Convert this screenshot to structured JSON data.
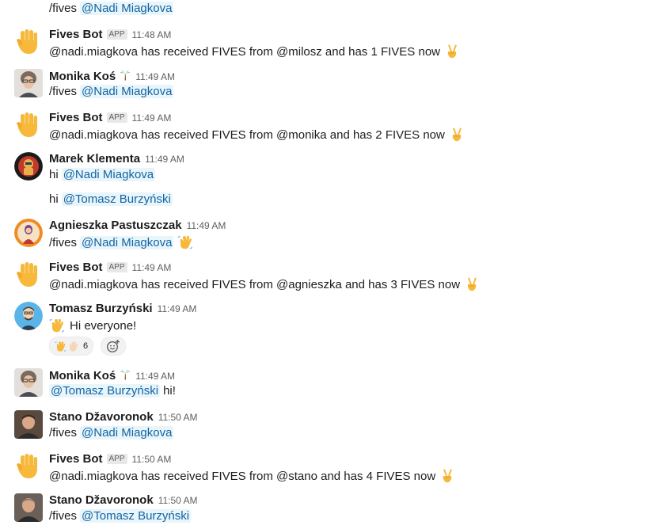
{
  "messages": [
    {
      "name": "",
      "badge": "",
      "time": "",
      "parts": [
        "/fives",
        "@Nadi Miagkova"
      ]
    },
    {
      "name": "Fives Bot",
      "badge": "APP",
      "time": "11:48 AM",
      "text": "@nadi.miagkova has received FIVES from @milosz and has 1 FIVES now"
    },
    {
      "name": "Monika Koś",
      "time": "11:49 AM",
      "parts": [
        "/fives",
        "@Nadi Miagkova"
      ]
    },
    {
      "name": "Fives Bot",
      "badge": "APP",
      "time": "11:49 AM",
      "text": "@nadi.miagkova has received FIVES from @monika and has 2 FIVES now"
    },
    {
      "name": "Marek Klementa",
      "time": "11:49 AM",
      "parts": [
        "hi",
        "@Nadi Miagkova"
      ],
      "parts2": [
        "hi",
        "@Tomasz Burzyński"
      ]
    },
    {
      "name": "Agnieszka Pastuszczak",
      "time": "11:49 AM",
      "parts": [
        "/fives",
        "@Nadi Miagkova"
      ]
    },
    {
      "name": "Fives Bot",
      "badge": "APP",
      "time": "11:49 AM",
      "text": "@nadi.miagkova has received FIVES from @agnieszka and has 3 FIVES now"
    },
    {
      "name": "Tomasz Burzyński",
      "time": "11:49 AM",
      "text": "Hi everyone!",
      "reaction_count": "6"
    },
    {
      "name": "Monika Koś",
      "time": "11:49 AM",
      "parts": [
        "@Tomasz Burzyński",
        "hi!"
      ]
    },
    {
      "name": "Stano Džavoronok",
      "time": "11:50 AM",
      "parts": [
        "/fives",
        "@Nadi Miagkova"
      ]
    },
    {
      "name": "Fives Bot",
      "badge": "APP",
      "time": "11:50 AM",
      "text": "@nadi.miagkova has received FIVES from @stano and has 4 FIVES now"
    },
    {
      "name": "Stano Džavoronok",
      "time": "11:50 AM",
      "parts": [
        "/fives",
        "@Tomasz Burzyński"
      ]
    }
  ],
  "icons": {
    "bot_avatar": "raised-hand-emoji",
    "victory": "victory-hand-emoji",
    "wave": "waving-hand-emoji",
    "palm": "palm-tree-emoji",
    "add_reaction": "add-reaction-icon"
  },
  "colors": {
    "mention_text": "#1264a3",
    "mention_bg": "#e8f5fa",
    "timestamp": "#616061"
  }
}
